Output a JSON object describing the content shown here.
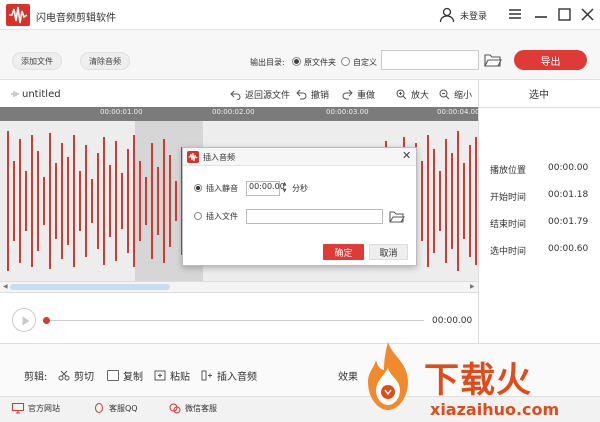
{
  "titlebar": {
    "app_title": "闪电音频剪辑软件",
    "user_label": "未登录",
    "icons": [
      "user-icon",
      "menu-icon",
      "minimize-icon",
      "maximize-icon",
      "close-icon"
    ]
  },
  "toolbar": {
    "add_file": "添加文件",
    "clear_audio": "清除音频",
    "output_dir_label": "输出目录:",
    "option_source": "原文件夹",
    "option_custom": "自定义",
    "path_value": "",
    "export": "导出"
  },
  "editor": {
    "file_name": "untitled",
    "back_to_source": "返回源文件",
    "undo": "撤销",
    "redo": "重做",
    "zoom_in": "放大",
    "zoom_out": "缩小",
    "ticks": [
      "00:00:01.00",
      "00:00:02.00",
      "00:00:03.00",
      "00:00:04.00"
    ]
  },
  "panel": {
    "title": "选中",
    "rows": [
      {
        "label": "播放位置",
        "value": "00:00.00"
      },
      {
        "label": "开始时间",
        "value": "00:01.18"
      },
      {
        "label": "结束时间",
        "value": "00:01.79"
      },
      {
        "label": "选中时间",
        "value": "00:00.60"
      }
    ]
  },
  "player": {
    "time": "00:00.00",
    "progress": 0
  },
  "editbar": {
    "label": "剪辑:",
    "cut": "剪切",
    "copy": "复制",
    "paste": "粘贴",
    "insert_audio": "插入音频",
    "effects": "效果"
  },
  "footer": {
    "website": "官方网站",
    "qq": "客服QQ",
    "wechat": "微信客服"
  },
  "dialog": {
    "title": "插入音频",
    "insert_silence": "插入静音",
    "silence_value": "00:00.00",
    "unit": "分秒",
    "insert_file": "插入文件",
    "file_value": "",
    "ok": "确定",
    "cancel": "取消"
  },
  "watermark": {
    "text": "下载火",
    "url": "xiazaihuo.com"
  },
  "colors": {
    "accent": "#df3a35",
    "waveform": "#d23a2f",
    "watermark": "#e24a17"
  }
}
